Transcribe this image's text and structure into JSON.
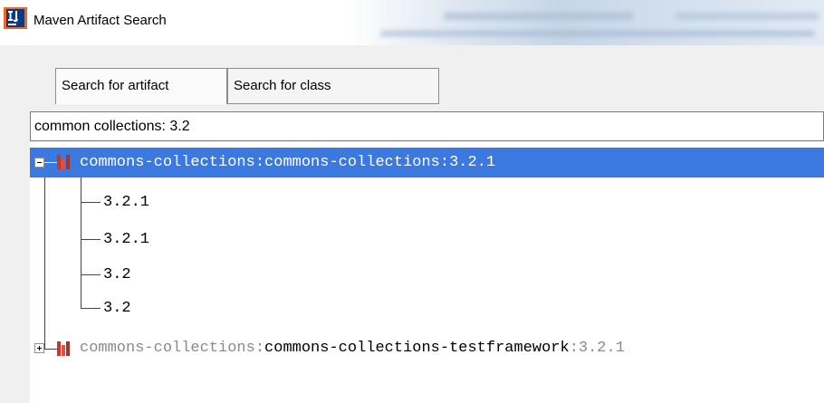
{
  "window": {
    "title": "Maven Artifact Search",
    "icon": "intellij-idea-icon"
  },
  "tabs": [
    {
      "label": "Search for artifact",
      "active": true
    },
    {
      "label": "Search for class",
      "active": false
    }
  ],
  "search": {
    "value": "common collections: 3.2"
  },
  "results": [
    {
      "group": "commons-collections",
      "artifact": "commons-collections",
      "version": "3.2.1",
      "expanded": true,
      "selected": true,
      "versions": [
        "3.2.1",
        "3.2.1",
        "3.2",
        "3.2"
      ]
    },
    {
      "group": "commons-collections",
      "artifact": "commons-collections-testframework",
      "version": "3.2.1",
      "expanded": false,
      "selected": false
    }
  ],
  "colors": {
    "selection": "#3b78e0",
    "library_icon": "#c0392b"
  }
}
